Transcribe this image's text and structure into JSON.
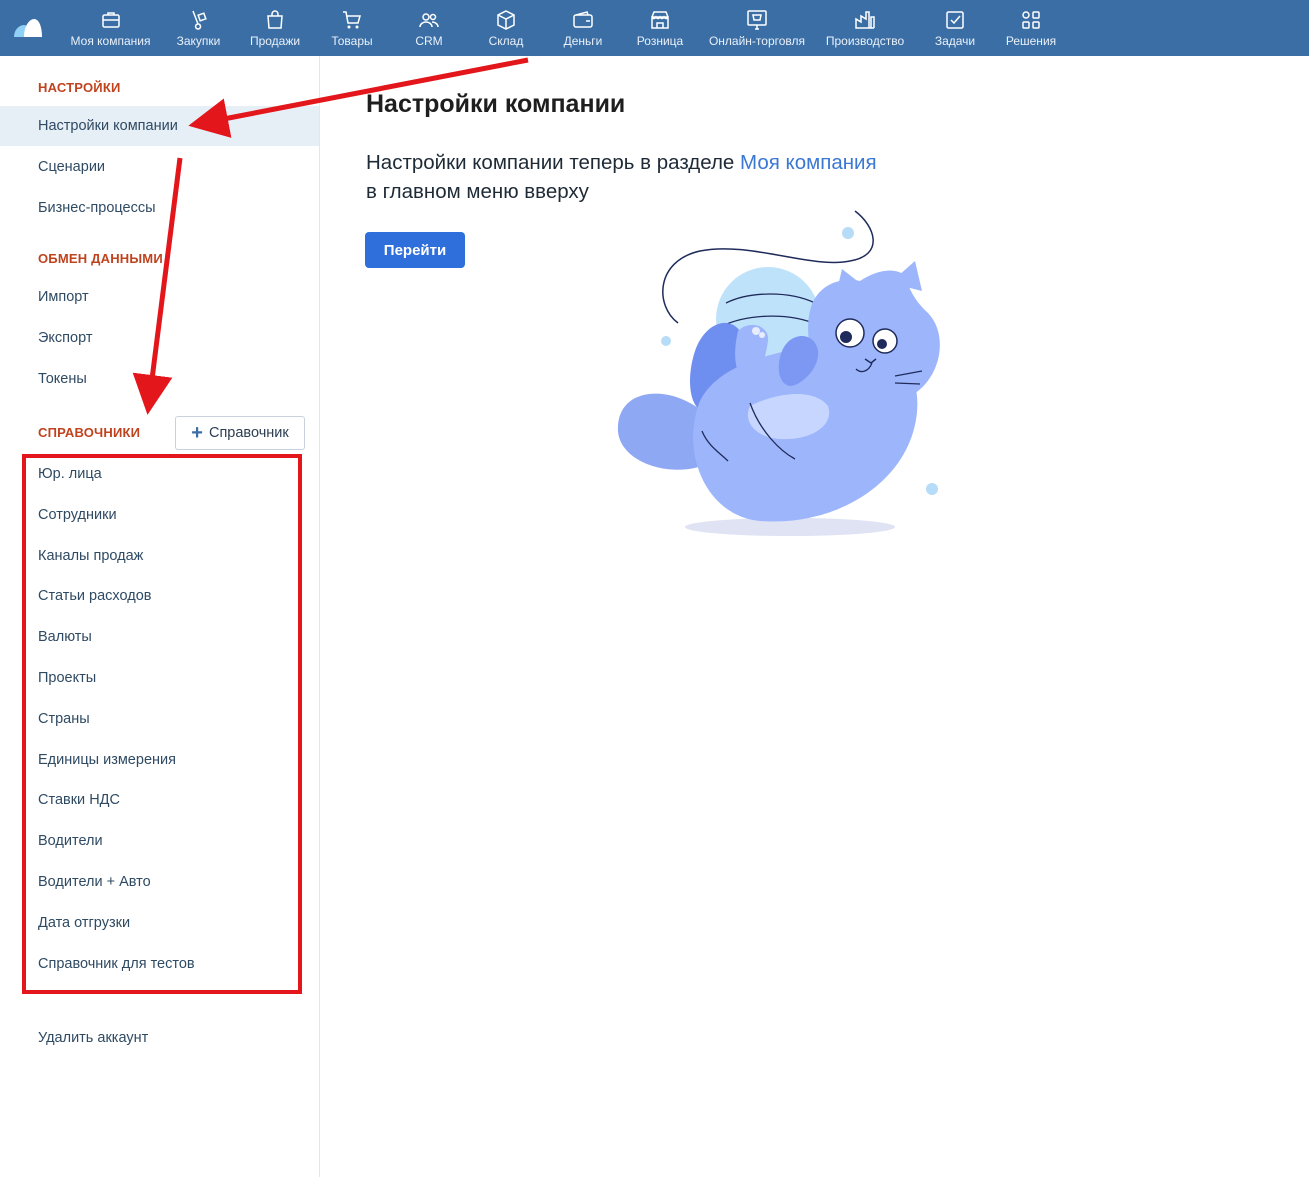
{
  "topbar": {
    "accent": "#3a6ea5",
    "items": [
      {
        "label": "Моя компания",
        "icon": "briefcase-icon"
      },
      {
        "label": "Закупки",
        "icon": "hand-truck-icon"
      },
      {
        "label": "Продажи",
        "icon": "shopping-bag-icon"
      },
      {
        "label": "Товары",
        "icon": "cart-icon"
      },
      {
        "label": "CRM",
        "icon": "people-icon"
      },
      {
        "label": "Склад",
        "icon": "box-icon"
      },
      {
        "label": "Деньги",
        "icon": "wallet-icon"
      },
      {
        "label": "Розница",
        "icon": "store-icon"
      },
      {
        "label": "Онлайн-торговля",
        "icon": "online-shop-icon"
      },
      {
        "label": "Производство",
        "icon": "factory-icon"
      },
      {
        "label": "Задачи",
        "icon": "task-check-icon"
      },
      {
        "label": "Решения",
        "icon": "grid-apps-icon"
      }
    ]
  },
  "sidebar": {
    "settings": {
      "title": "НАСТРОЙКИ",
      "items": [
        "Настройки компании",
        "Сценарии",
        "Бизнес-процессы"
      ]
    },
    "exchange": {
      "title": "ОБМЕН ДАННЫМИ",
      "items": [
        "Импорт",
        "Экспорт",
        "Токены"
      ]
    },
    "directories": {
      "title": "СПРАВОЧНИКИ",
      "add_label": "Справочник",
      "items": [
        "Юр. лица",
        "Сотрудники",
        "Каналы продаж",
        "Статьи расходов",
        "Валюты",
        "Проекты",
        "Страны",
        "Единицы измерения",
        "Ставки НДС",
        "Водители",
        "Водители + Авто",
        "Дата отгрузки",
        "Справочник для тестов"
      ]
    },
    "delete_account": "Удалить аккаунт"
  },
  "main": {
    "title": "Настройки компании",
    "info_prefix": "Настройки компании теперь в разделе ",
    "info_link": "Моя компания",
    "info_suffix": "в главном меню вверху",
    "go_button": "Перейти"
  },
  "colors": {
    "section_title": "#c0431f",
    "link": "#3a78d4",
    "button": "#2f6fdc",
    "annotation": "#e3161b"
  }
}
